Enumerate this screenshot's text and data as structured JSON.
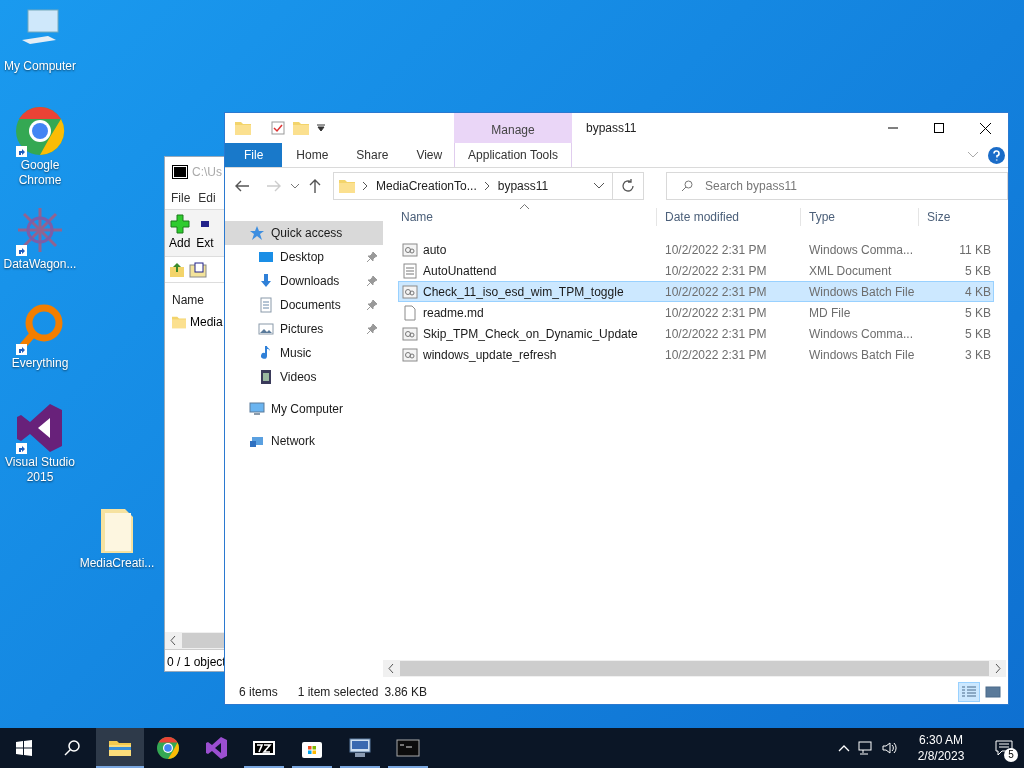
{
  "desktop_icons": [
    {
      "label": "My Computer",
      "kind": "computer",
      "shortcut": false
    },
    {
      "label": "Google Chrome",
      "kind": "chrome",
      "shortcut": true
    },
    {
      "label": "DataWagon...",
      "kind": "datawagon",
      "shortcut": true
    },
    {
      "label": "Everything",
      "kind": "everything",
      "shortcut": true
    },
    {
      "label": "Visual Studio 2015",
      "kind": "vs",
      "shortcut": true
    },
    {
      "label": "MediaCreati...",
      "kind": "folder",
      "shortcut": false
    }
  ],
  "background_window": {
    "title": "C:\\Us",
    "menu": [
      "File",
      "Edi"
    ],
    "toolbar": [
      {
        "label": "Add",
        "kind": "add"
      },
      {
        "label": "Ext",
        "kind": "extract"
      }
    ],
    "column": "Name",
    "rows": [
      "Media"
    ],
    "status": "0 / 1 object"
  },
  "explorer": {
    "title": "bypass11",
    "context_group": "Manage",
    "ribbon_tabs": [
      {
        "label": "File",
        "kind": "file"
      },
      {
        "label": "Home",
        "kind": "tab"
      },
      {
        "label": "Share",
        "kind": "tab"
      },
      {
        "label": "View",
        "kind": "tab"
      }
    ],
    "context_tab": "Application Tools",
    "breadcrumb": [
      "MediaCreationTo...",
      "bypass11"
    ],
    "search": {
      "placeholder": "Search bypass11"
    },
    "sidebar": [
      {
        "label": "Quick access",
        "kind": "star",
        "selected": true,
        "children": [
          {
            "label": "Desktop",
            "kind": "desktop",
            "pinned": true,
            "selected": false
          },
          {
            "label": "Downloads",
            "kind": "downloads",
            "pinned": true,
            "selected": false
          },
          {
            "label": "Documents",
            "kind": "documents",
            "pinned": true,
            "selected": false
          },
          {
            "label": "Pictures",
            "kind": "pictures",
            "pinned": true,
            "selected": false
          },
          {
            "label": "Music",
            "kind": "music",
            "pinned": false,
            "selected": false
          },
          {
            "label": "Videos",
            "kind": "videos",
            "pinned": false,
            "selected": false
          }
        ]
      },
      {
        "label": "My Computer",
        "kind": "computer",
        "selected": false
      },
      {
        "label": "Network",
        "kind": "network",
        "selected": false
      }
    ],
    "columns": [
      "Name",
      "Date modified",
      "Type",
      "Size"
    ],
    "rows": [
      {
        "name": "auto",
        "date": "10/2/2022 2:31 PM",
        "type": "Windows Comma...",
        "size": "11 KB",
        "kind": "script",
        "selected": false
      },
      {
        "name": "AutoUnattend",
        "date": "10/2/2022 2:31 PM",
        "type": "XML Document",
        "size": "5 KB",
        "kind": "xml",
        "selected": false
      },
      {
        "name": "Check_11_iso_esd_wim_TPM_toggle",
        "date": "10/2/2022 2:31 PM",
        "type": "Windows Batch File",
        "size": "4 KB",
        "kind": "script",
        "selected": true
      },
      {
        "name": "readme.md",
        "date": "10/2/2022 2:31 PM",
        "type": "MD File",
        "size": "5 KB",
        "kind": "text",
        "selected": false
      },
      {
        "name": "Skip_TPM_Check_on_Dynamic_Update",
        "date": "10/2/2022 2:31 PM",
        "type": "Windows Comma...",
        "size": "5 KB",
        "kind": "script",
        "selected": false
      },
      {
        "name": "windows_update_refresh",
        "date": "10/2/2022 2:31 PM",
        "type": "Windows Batch File",
        "size": "3 KB",
        "kind": "script",
        "selected": false
      }
    ],
    "status": {
      "count": "6 items",
      "selection": "1 item selected",
      "size": "3.86 KB"
    },
    "views": [
      {
        "kind": "details",
        "selected": true
      },
      {
        "kind": "large",
        "selected": false
      }
    ]
  },
  "taskbar": {
    "apps": [
      {
        "kind": "explorer",
        "selected": true,
        "running": true
      },
      {
        "kind": "chrome",
        "selected": false,
        "running": false
      },
      {
        "kind": "vs",
        "selected": false,
        "running": false
      },
      {
        "kind": "sevenzip",
        "selected": false,
        "running": true
      },
      {
        "kind": "store",
        "selected": false,
        "running": true
      },
      {
        "kind": "remote",
        "selected": false,
        "running": true
      },
      {
        "kind": "terminal",
        "selected": false,
        "running": true
      }
    ],
    "time": "6:30 AM",
    "date": "2/8/2023",
    "notifications": "5"
  }
}
